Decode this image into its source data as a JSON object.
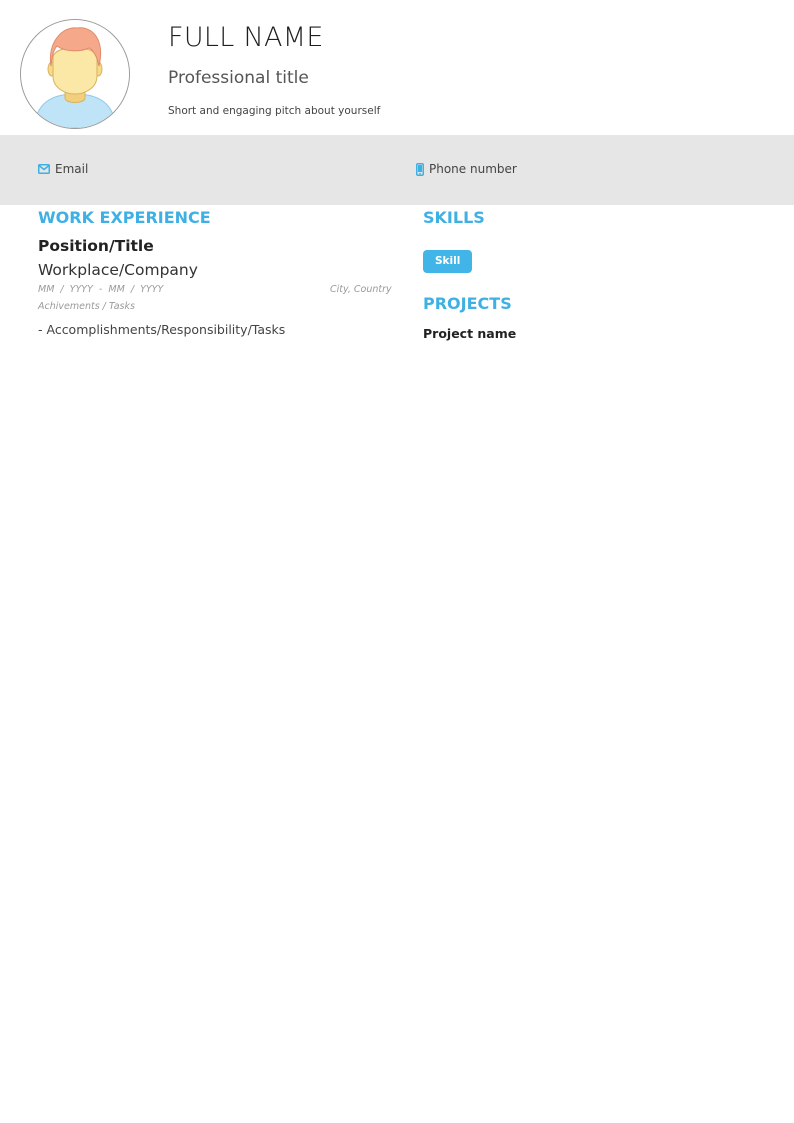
{
  "header": {
    "full_name": "FULL NAME",
    "professional_title": "Professional title",
    "pitch": "Short and engaging pitch about yourself",
    "avatar_icon": "user-avatar-icon"
  },
  "contact": {
    "email_label": "Email",
    "email_icon": "envelope-icon",
    "phone_label": "Phone number",
    "phone_icon": "mobile-phone-icon"
  },
  "work_experience": {
    "heading": "WORK EXPERIENCE",
    "entries": [
      {
        "position": "Position/Title",
        "workplace": "Workplace/Company",
        "dates": "MM  /  YYYY  -  MM  /  YYYY",
        "location": "City, Country",
        "achievements_label": "Achivements / Tasks",
        "items": [
          "- Accomplishments/Responsibility/Tasks"
        ]
      }
    ]
  },
  "skills": {
    "heading": "SKILLS",
    "items": [
      "Skill"
    ]
  },
  "projects": {
    "heading": "PROJECTS",
    "items": [
      {
        "name": "Project name"
      }
    ]
  },
  "colors": {
    "accent": "#3fb0e3",
    "badge": "#42b5e8",
    "contact_bar": "#e6e6e6"
  }
}
